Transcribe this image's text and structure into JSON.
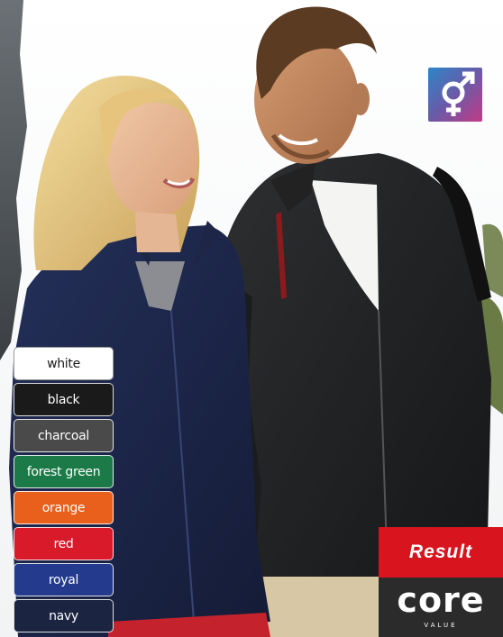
{
  "swatches": [
    {
      "label": "white",
      "color": "#ffffff",
      "text_color": "#1a1a1a"
    },
    {
      "label": "black",
      "color": "#1a1a1a",
      "text_color": "#ffffff"
    },
    {
      "label": "charcoal",
      "color": "#4a4a4a",
      "text_color": "#ffffff"
    },
    {
      "label": "forest green",
      "color": "#1c7a48",
      "text_color": "#ffffff"
    },
    {
      "label": "orange",
      "color": "#e8601c",
      "text_color": "#ffffff"
    },
    {
      "label": "red",
      "color": "#d81a2a",
      "text_color": "#ffffff"
    },
    {
      "label": "royal",
      "color": "#243a8c",
      "text_color": "#ffffff"
    },
    {
      "label": "navy",
      "color": "#1b2440",
      "text_color": "#ffffff"
    }
  ],
  "brand": {
    "result_label": "Result",
    "result_bg": "#d8141e",
    "core_label": "core",
    "value_label": "VALUE",
    "core_bg": "#2b2b2b"
  },
  "badge": {
    "icon": "unisex-symbol-icon"
  }
}
